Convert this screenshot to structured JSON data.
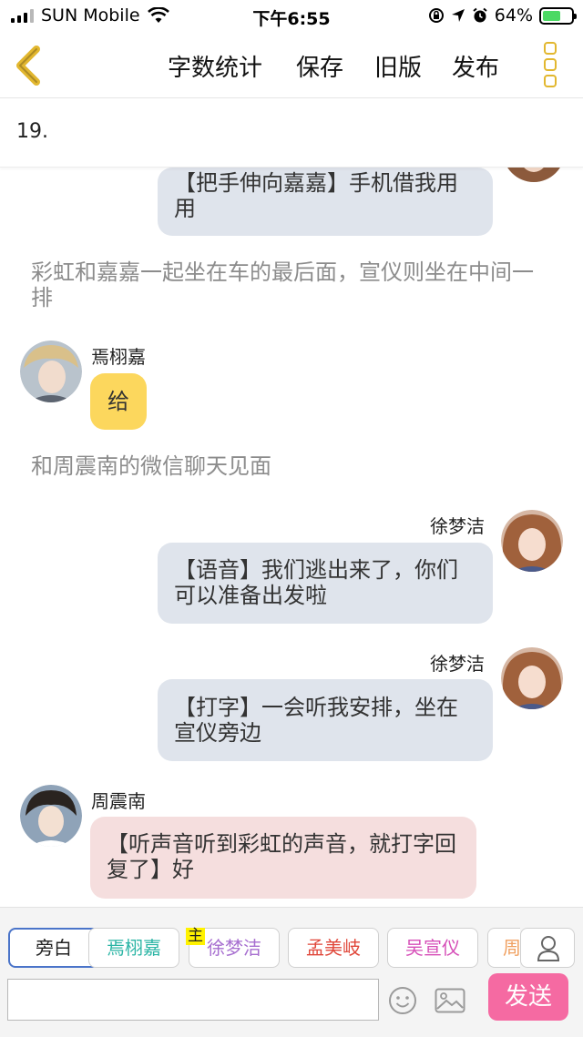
{
  "status_bar": {
    "carrier": "SUN Mobile",
    "time": "下午6:55",
    "battery": "64%",
    "battery_level": 0.64
  },
  "nav": {
    "word_count": "字数统计",
    "save": "保存",
    "old_version": "旧版",
    "publish": "发布"
  },
  "chapter_title": "19.",
  "messages": [
    {
      "type": "bubble",
      "side": "right",
      "speaker": "",
      "text": "【把手伸向嘉嘉】手机借我用用",
      "color": "#dfe4ec"
    },
    {
      "type": "narration",
      "text": "彩虹和嘉嘉一起坐在车的最后面，宣仪则坐在中间一排"
    },
    {
      "type": "bubble",
      "side": "left",
      "speaker": "焉栩嘉",
      "text": "给",
      "color": "#fcd75d"
    },
    {
      "type": "narration",
      "text": "和周震南的微信聊天见面"
    },
    {
      "type": "bubble",
      "side": "right",
      "speaker": "徐梦洁",
      "text": "【语音】我们逃出来了，你们可以准备出发啦",
      "color": "#dfe4ec"
    },
    {
      "type": "bubble",
      "side": "right",
      "speaker": "徐梦洁",
      "text": "【打字】一会听我安排，坐在宣仪旁边",
      "color": "#dfe4ec"
    },
    {
      "type": "bubble",
      "side": "left",
      "speaker": "周震南",
      "text": "【听声音听到彩虹的声音，就打字回复了】好",
      "color": "#f5dede"
    }
  ],
  "characters": [
    {
      "label": "旁白",
      "color": "#222222",
      "selected": true
    },
    {
      "label": "焉栩嘉",
      "color": "#2bb5a5"
    },
    {
      "label": "徐梦洁",
      "color": "#a76fd0",
      "tag": "主"
    },
    {
      "label": "孟美岐",
      "color": "#e0473a"
    },
    {
      "label": "吴宣仪",
      "color": "#d64fb8"
    },
    {
      "label": "周",
      "color": "#f0a060"
    }
  ],
  "input": {
    "value": "",
    "placeholder": ""
  },
  "send_label": "发送",
  "icons": {
    "back": "chevron-left-icon",
    "more": "more-vertical-icon",
    "user": "user-icon",
    "emoji": "smile-icon",
    "image": "image-icon"
  },
  "colors": {
    "accent": "#e2b72f",
    "send": "#f56aa2",
    "selected_border": "#4a74c9"
  }
}
